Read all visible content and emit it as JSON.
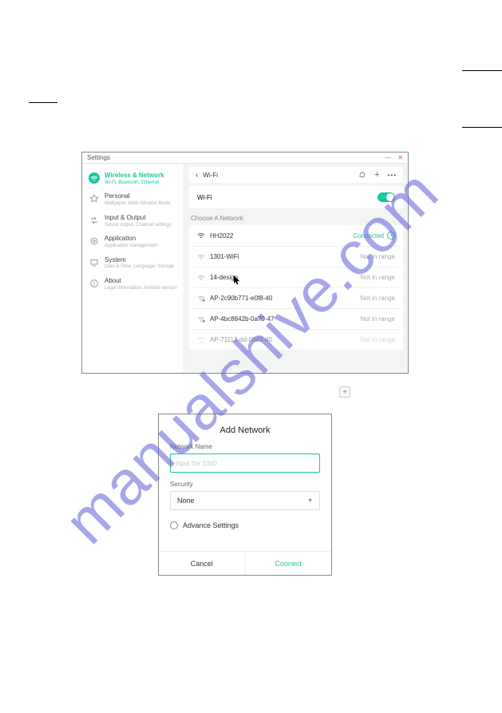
{
  "document": {
    "watermark": "manualshive.com"
  },
  "settings_window": {
    "title": "Settings",
    "sidebar": {
      "items": [
        {
          "title": "Wireless & Network",
          "subtitle": "Wi-Fi, Bluetooth, Ethernet",
          "icon": "wifi-icon",
          "active": true
        },
        {
          "title": "Personal",
          "subtitle": "Wallpaper, Multi-Window Mode",
          "icon": "star-icon"
        },
        {
          "title": "Input & Output",
          "subtitle": "Sound output, Channel settings",
          "icon": "io-icon"
        },
        {
          "title": "Application",
          "subtitle": "Application management",
          "icon": "app-icon"
        },
        {
          "title": "System",
          "subtitle": "Date & Time, Language, Storage",
          "icon": "system-icon"
        },
        {
          "title": "About",
          "subtitle": "Legal information, Android version",
          "icon": "info-icon"
        }
      ]
    },
    "panel": {
      "back_label": "Wi-Fi",
      "wifi_toggle_label": "Wi-Fi",
      "choose_label": "Choose A Network",
      "networks": [
        {
          "name": "HH2022",
          "status": "Connected",
          "status_type": "connected"
        },
        {
          "name": "1301-WiFi",
          "status": "Not in range",
          "status_type": "out"
        },
        {
          "name": "14-design",
          "status": "Not in range",
          "status_type": "out",
          "cursor": true
        },
        {
          "name": "AP-2c90b771-e0f8-40",
          "status": "Not in range",
          "status_type": "out"
        },
        {
          "name": "AP-4bc8842b-0a79-47",
          "status": "Not in range",
          "status_type": "out"
        },
        {
          "name": "AP-71113-dd-08d3-40",
          "status": "Not in range",
          "status_type": "out"
        }
      ]
    }
  },
  "add_network_dialog": {
    "title": "Add Network",
    "name_label": "Network Name",
    "ssid_placeholder": "Input the SSID",
    "security_label": "Security",
    "security_value": "None",
    "advance_label": "Advance Settings",
    "cancel_label": "Cancel",
    "connect_label": "Connect"
  }
}
